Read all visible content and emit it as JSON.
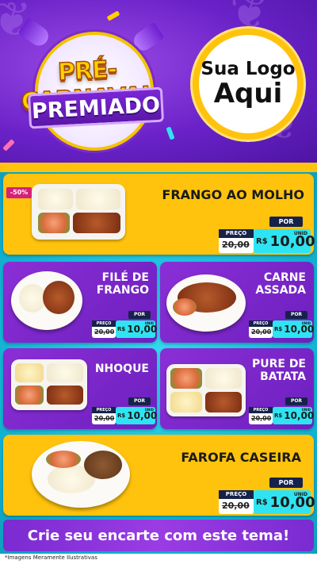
{
  "header": {
    "title_line1": "PRÉ-CARNAVAL",
    "title_line2": "PREMIADO",
    "logo_line1": "Sua Logo",
    "logo_line2": "Aqui"
  },
  "badge": {
    "discount": "-50%"
  },
  "price": {
    "por": "POR",
    "preco": "PREÇO",
    "old": "20,00",
    "currency": "R$",
    "value": "10,00",
    "unit": "UNID"
  },
  "products": [
    {
      "name": "FRANGO AO MOLHO"
    },
    {
      "name_l1": "FILÉ DE",
      "name_l2": "FRANGO"
    },
    {
      "name_l1": "CARNE",
      "name_l2": "ASSADA"
    },
    {
      "name": "NHOQUE"
    },
    {
      "name_l1": "PURE DE",
      "name_l2": "BATATA"
    },
    {
      "name": "FAROFA CASEIRA"
    }
  ],
  "footer": {
    "cta": "Crie seu encarte com este tema!",
    "disclaimer": "*Imagens Meramente Ilustrativas"
  },
  "colors": {
    "purple": "#7a2bd1",
    "yellow": "#ffc30d",
    "cyan": "#2fe4f2",
    "navy": "#16224a"
  }
}
